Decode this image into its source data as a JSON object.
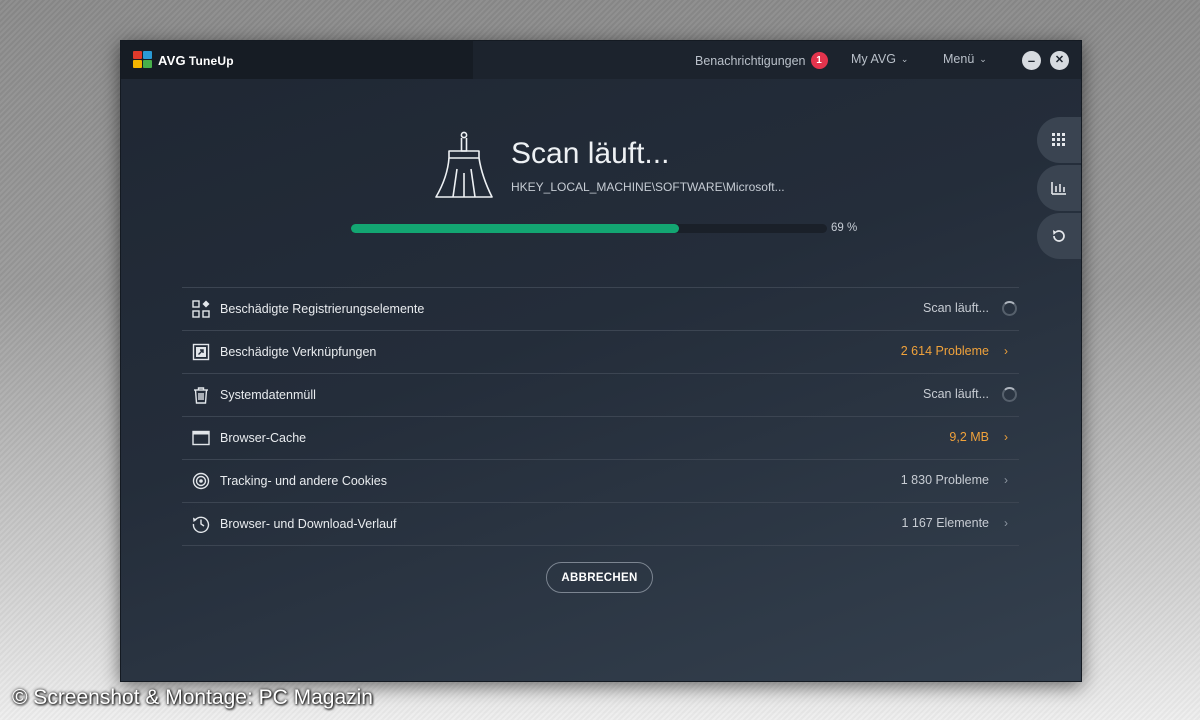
{
  "app": {
    "brand": "AVG",
    "product": "TuneUp"
  },
  "titlebar": {
    "notifications_label": "Benachrichtigungen",
    "notifications_count": "1",
    "my_avg_label": "My AVG",
    "menu_label": "Menü",
    "minimize_symbol": "–",
    "close_symbol": "✕"
  },
  "side_nav": {
    "items": [
      {
        "icon": "grid-icon"
      },
      {
        "icon": "bar-chart-icon"
      },
      {
        "icon": "undo-icon"
      }
    ]
  },
  "scan": {
    "title": "Scan läuft...",
    "current_path": "HKEY_LOCAL_MACHINE\\SOFTWARE\\Microsoft...",
    "progress_percent": 69,
    "progress_label": "69 %"
  },
  "results": [
    {
      "label": "Beschädigte Registrierungselemente",
      "value": "Scan läuft...",
      "state": "scanning",
      "icon": "registry-icon"
    },
    {
      "label": "Beschädigte Verknüpfungen",
      "value": "2 614 Probleme",
      "state": "highlight",
      "icon": "shortcut-icon"
    },
    {
      "label": "Systemdatenmüll",
      "value": "Scan läuft...",
      "state": "scanning",
      "icon": "trash-icon"
    },
    {
      "label": "Browser-Cache",
      "value": "9,2 MB",
      "state": "highlight",
      "icon": "browser-window-icon"
    },
    {
      "label": "Tracking- und andere Cookies",
      "value": "1 830 Probleme",
      "state": "done",
      "icon": "target-icon"
    },
    {
      "label": "Browser- und Download-Verlauf",
      "value": "1 167 Elemente",
      "state": "done",
      "icon": "history-icon"
    }
  ],
  "actions": {
    "cancel_label": "ABBRECHEN"
  },
  "watermark": "© Screenshot & Montage: PC Magazin",
  "colors": {
    "accent_green": "#13a672",
    "highlight_orange": "#f0a23b",
    "badge_red": "#e4344d",
    "window_bg": "#242d3a"
  }
}
